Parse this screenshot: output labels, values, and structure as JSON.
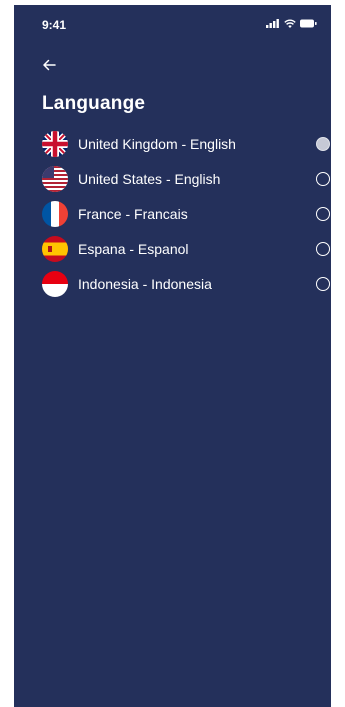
{
  "status_bar": {
    "time": "9:41",
    "icons": [
      "signal-icon",
      "wifi-icon",
      "battery-icon"
    ]
  },
  "header": {
    "back_icon": "arrow-left-icon",
    "title": "Languange"
  },
  "languages": [
    {
      "label": "United Kingdom - English",
      "flag": "uk-flag-icon",
      "selected": true
    },
    {
      "label": "United States - English",
      "flag": "us-flag-icon",
      "selected": false
    },
    {
      "label": "France - Francais",
      "flag": "france-flag-icon",
      "selected": false
    },
    {
      "label": "Espana - Espanol",
      "flag": "spain-flag-icon",
      "selected": false
    },
    {
      "label": "Indonesia - Indonesia",
      "flag": "indonesia-flag-icon",
      "selected": false
    }
  ],
  "colors": {
    "background": "#24305b",
    "text": "#ffffff",
    "selected_radio": "#c6c9d6"
  }
}
